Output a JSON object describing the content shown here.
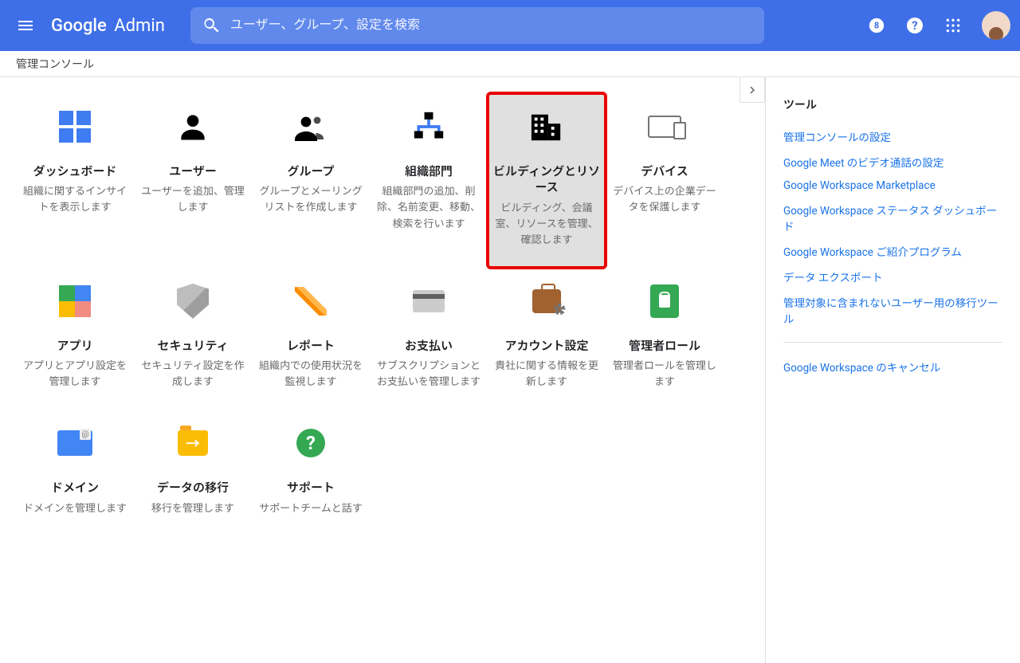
{
  "header": {
    "product": "Google",
    "product_sub": "Admin",
    "search_placeholder": "ユーザー、グループ、設定を検索"
  },
  "breadcrumb": "管理コンソール",
  "tiles": [
    {
      "id": "dashboard",
      "title": "ダッシュボード",
      "desc": "組織に関するインサイトを表示します"
    },
    {
      "id": "users",
      "title": "ユーザー",
      "desc": "ユーザーを追加、管理します"
    },
    {
      "id": "groups",
      "title": "グループ",
      "desc": "グループとメーリング リストを作成します"
    },
    {
      "id": "orgunits",
      "title": "組織部門",
      "desc": "組織部門の追加、削除、名前変更、移動、検索を行います"
    },
    {
      "id": "buildings",
      "title": "ビルディングとリソース",
      "desc": "ビルディング、会議室、リソースを管理、確認します",
      "highlight": true
    },
    {
      "id": "devices",
      "title": "デバイス",
      "desc": "デバイス上の企業データを保護します"
    },
    {
      "id": "apps",
      "title": "アプリ",
      "desc": "アプリとアプリ設定を管理します"
    },
    {
      "id": "security",
      "title": "セキュリティ",
      "desc": "セキュリティ設定を作成します"
    },
    {
      "id": "reports",
      "title": "レポート",
      "desc": "組織内での使用状況を監視します"
    },
    {
      "id": "billing",
      "title": "お支払い",
      "desc": "サブスクリプションとお支払いを管理します"
    },
    {
      "id": "account",
      "title": "アカウント設定",
      "desc": "貴社に関する情報を更新します"
    },
    {
      "id": "adminroles",
      "title": "管理者ロール",
      "desc": "管理者ロールを管理します"
    },
    {
      "id": "domains",
      "title": "ドメイン",
      "desc": "ドメインを管理します"
    },
    {
      "id": "migration",
      "title": "データの移行",
      "desc": "移行を管理します"
    },
    {
      "id": "support",
      "title": "サポート",
      "desc": "サポートチームと話す"
    }
  ],
  "sidebar": {
    "title": "ツール",
    "links_a": [
      "管理コンソールの設定",
      "Google Meet のビデオ通話の設定",
      "Google Workspace Marketplace",
      "Google Workspace ステータス ダッシュボード",
      "Google Workspace ご紹介プログラム",
      "データ エクスポート",
      "管理対象に含まれないユーザー用の移行ツール"
    ],
    "links_b": [
      "Google Workspace のキャンセル"
    ]
  }
}
